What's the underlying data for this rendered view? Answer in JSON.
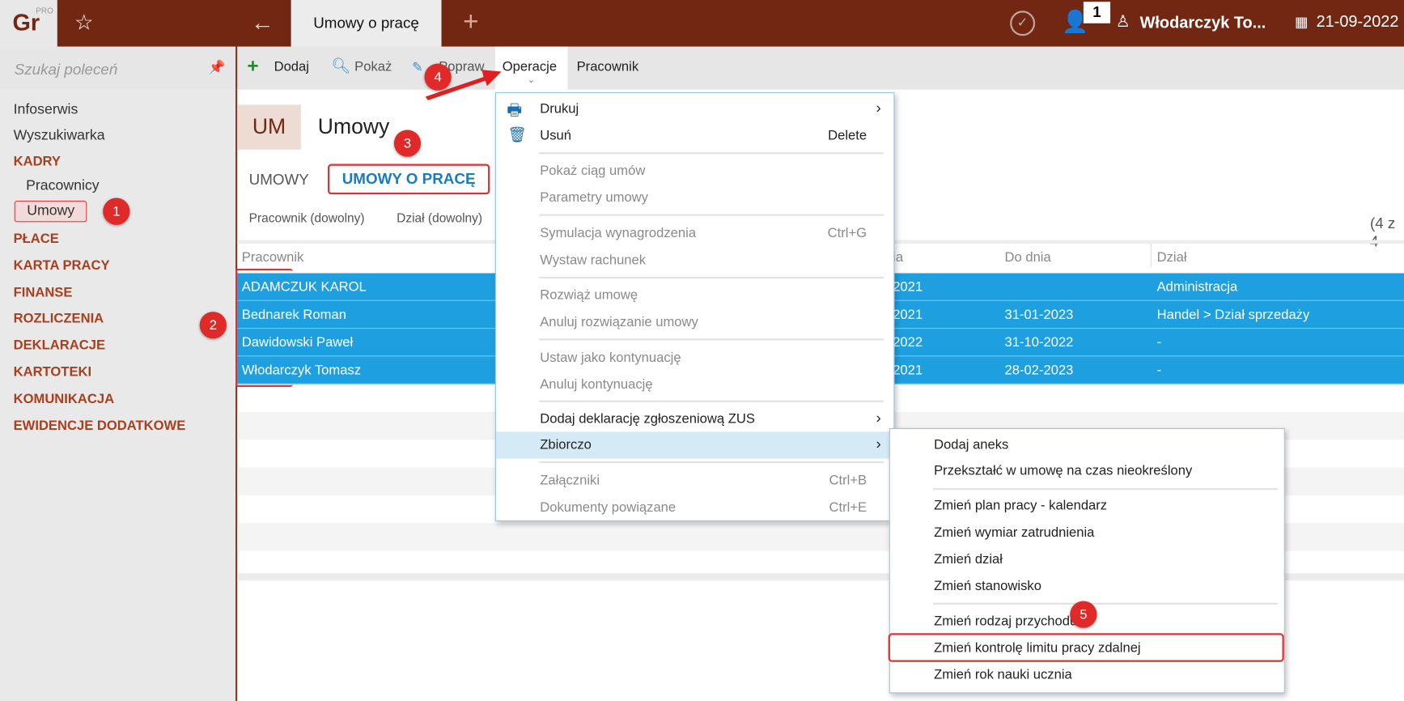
{
  "app": {
    "logo": "Gr",
    "logo_sup": "PRO",
    "tab": "Umowy o pracę",
    "badge_count": "1",
    "user": "Włodarczyk To...",
    "date": "21-09-2022"
  },
  "sidebar": {
    "search_placeholder": "Szukaj poleceń",
    "items": [
      {
        "label": "Infoserwis",
        "type": "item"
      },
      {
        "label": "Wyszukiwarka",
        "type": "item"
      },
      {
        "label": "KADRY",
        "type": "header"
      },
      {
        "label": "Pracownicy",
        "type": "sub"
      },
      {
        "label": "Umowy",
        "type": "sub-active"
      },
      {
        "label": "PŁACE",
        "type": "header"
      },
      {
        "label": "KARTA PRACY",
        "type": "header"
      },
      {
        "label": "FINANSE",
        "type": "header"
      },
      {
        "label": "ROZLICZENIA",
        "type": "header"
      },
      {
        "label": "DEKLARACJE",
        "type": "header"
      },
      {
        "label": "KARTOTEKI",
        "type": "header"
      },
      {
        "label": "KOMUNIKACJA",
        "type": "header"
      },
      {
        "label": "EWIDENCJE DODATKOWE",
        "type": "header"
      }
    ]
  },
  "toolbar": {
    "add": "Dodaj",
    "show": "Pokaż",
    "edit": "Popraw",
    "operations": "Operacje",
    "employee": "Pracownik"
  },
  "page": {
    "code": "UM",
    "title": "Umowy",
    "tabs": [
      "UMOWY",
      "UMOWY O PRACĘ"
    ],
    "filters": [
      "Pracownik (dowolny)",
      "Dział (dowolny)"
    ],
    "count": "(4 z 4"
  },
  "table": {
    "headers": [
      "Pracownik",
      "ia",
      "Do dnia",
      "Dział"
    ],
    "rows": [
      [
        "ADAMCZUK KAROL",
        "2021",
        "",
        "Administracja"
      ],
      [
        "Bednarek Roman",
        "2021",
        "31-01-2023",
        "Handel > Dział sprzedaży"
      ],
      [
        "Dawidowski Paweł",
        "2022",
        "31-10-2022",
        "-"
      ],
      [
        "Włodarczyk Tomasz",
        "2021",
        "28-02-2023",
        "-"
      ]
    ]
  },
  "menu": {
    "items": [
      {
        "label": "Drukuj",
        "arrow": "›"
      },
      {
        "label": "Usuń",
        "shortcut": "Delete"
      },
      {
        "label": "Pokaż ciąg umów"
      },
      {
        "label": "Parametry umowy"
      },
      {
        "label": "Symulacja wynagrodzenia",
        "shortcut": "Ctrl+G"
      },
      {
        "label": "Wystaw rachunek"
      },
      {
        "label": "Rozwiąż umowę"
      },
      {
        "label": "Anuluj rozwiązanie umowy"
      },
      {
        "label": "Ustaw jako kontynuację"
      },
      {
        "label": "Anuluj kontynuację"
      },
      {
        "label": "Dodaj deklarację zgłoszeniową ZUS",
        "arrow": "›"
      },
      {
        "label": "Zbiorczo",
        "arrow": "›"
      },
      {
        "label": "Załączniki",
        "shortcut": "Ctrl+B"
      },
      {
        "label": "Dokumenty powiązane",
        "shortcut": "Ctrl+E"
      }
    ]
  },
  "submenu": {
    "items": [
      "Dodaj aneks",
      "Przekształć w umowę na czas nieokreślony",
      "Zmień plan pracy - kalendarz",
      "Zmień wymiar zatrudnienia",
      "Zmień dział",
      "Zmień stanowisko",
      "Zmień rodzaj przychodu",
      "Zmień kontrolę limitu pracy zdalnej",
      "Zmień rok nauki ucznia"
    ]
  },
  "annotations": [
    "1",
    "2",
    "3",
    "4",
    "5"
  ],
  "colors": {
    "brand": "#722712",
    "selection": "#1ea0e0",
    "accent_tab": "#1a7cb8",
    "annotation": "#e02a2a"
  }
}
